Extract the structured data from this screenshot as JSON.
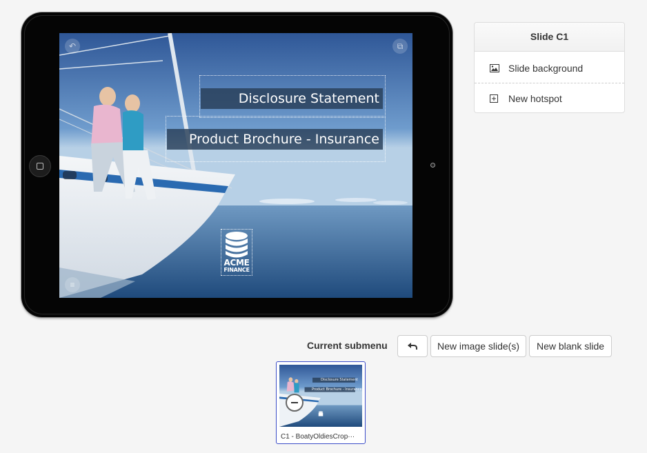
{
  "slide": {
    "banners": [
      "Disclosure Statement",
      "Product Brochure - Insurance"
    ],
    "logo": {
      "line1": "ACME",
      "line2": "FINANCE"
    },
    "icons": {
      "back": "undo-arrow-icon",
      "share": "external-link-icon",
      "menu": "hamburger-menu-icon"
    }
  },
  "panel": {
    "title": "Slide C1",
    "items": [
      {
        "label": "Slide background",
        "icon": "image-icon"
      },
      {
        "label": "New hotspot",
        "icon": "plus-square-icon"
      }
    ]
  },
  "toolbar": {
    "label": "Current submenu",
    "back_icon": "undo-arrow-icon",
    "new_image": "New image slide(s)",
    "new_blank": "New blank slide"
  },
  "thumbnails": [
    {
      "caption": "C1 - BoatyOldiesCrop···",
      "banners": [
        "Disclosure Statement",
        "Product Brochure - Insurance"
      ]
    }
  ],
  "colors": {
    "selection_border": "#3b4cc8",
    "banner_bg": "#283e58"
  }
}
